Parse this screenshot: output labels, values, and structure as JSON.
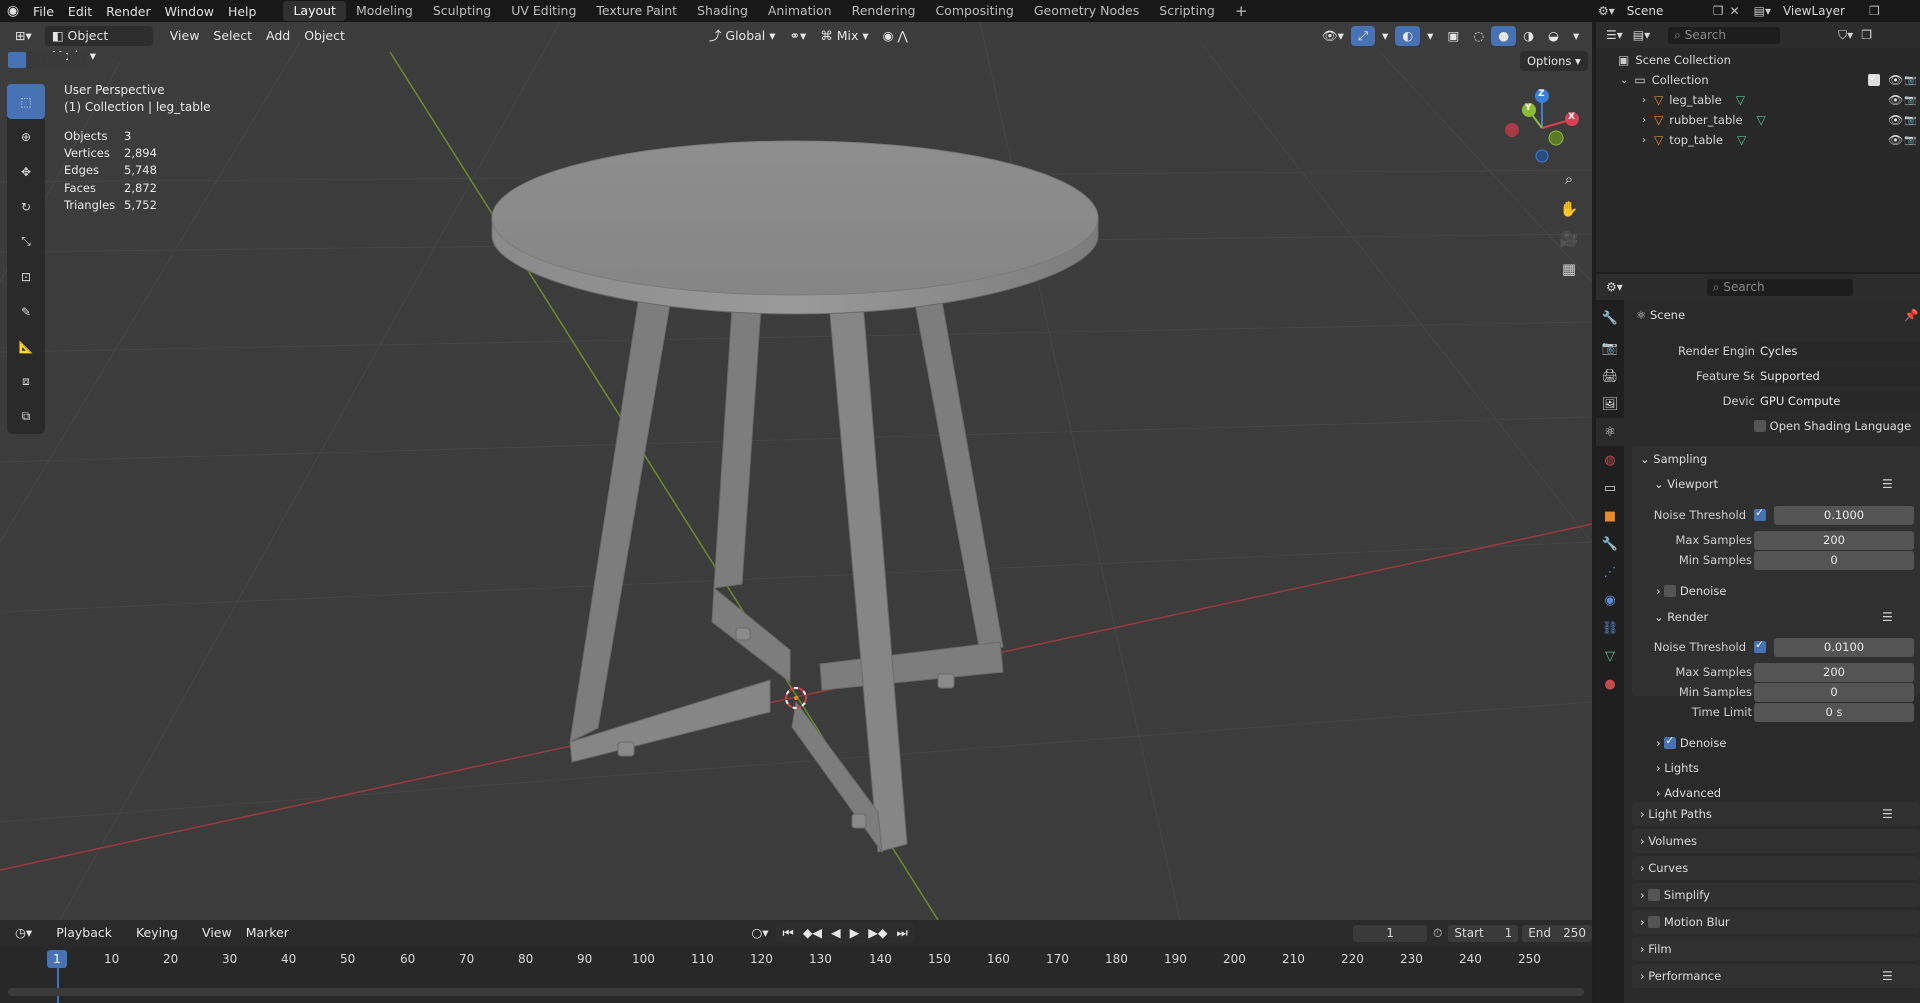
{
  "top_menu": {
    "items": [
      "File",
      "Edit",
      "Render",
      "Window",
      "Help"
    ]
  },
  "workspaces": {
    "tabs": [
      "Layout",
      "Modeling",
      "Sculpting",
      "UV Editing",
      "Texture Paint",
      "Shading",
      "Animation",
      "Rendering",
      "Compositing",
      "Geometry Nodes",
      "Scripting"
    ],
    "active": "Layout",
    "add": "+"
  },
  "scene_selector": {
    "scene": "Scene",
    "view_layer": "ViewLayer"
  },
  "viewport_header": {
    "mode": "Object Mode",
    "view": "View",
    "select": "Select",
    "add": "Add",
    "object": "Object",
    "orientation": "Global",
    "pivot": "Mix",
    "options": "Options"
  },
  "viewport_overlay": {
    "perspective": "User Perspective",
    "collection": "(1) Collection | leg_table",
    "stats": [
      {
        "label": "Objects",
        "value": "3"
      },
      {
        "label": "Vertices",
        "value": "2,894"
      },
      {
        "label": "Edges",
        "value": "5,748"
      },
      {
        "label": "Faces",
        "value": "2,872"
      },
      {
        "label": "Triangles",
        "value": "5,752"
      }
    ]
  },
  "gizmo_axes": {
    "x": "X",
    "y": "Y",
    "z": "Z"
  },
  "timeline": {
    "playback": "Playback",
    "keying": "Keying",
    "view": "View",
    "marker": "Marker",
    "current_frame": "1",
    "start_label": "Start",
    "start": "1",
    "end_label": "End",
    "end": "250",
    "ruler_current": "1",
    "ticks": [
      "10",
      "20",
      "30",
      "40",
      "50",
      "60",
      "70",
      "80",
      "90",
      "100",
      "110",
      "120",
      "130",
      "140",
      "150",
      "160",
      "170",
      "180",
      "190",
      "200",
      "210",
      "220",
      "230",
      "240",
      "250"
    ]
  },
  "outliner": {
    "search_placeholder": "Search",
    "scene_collection": "Scene Collection",
    "collection": "Collection",
    "objects": [
      "leg_table",
      "rubber_table",
      "top_table"
    ]
  },
  "properties": {
    "search_placeholder": "Search",
    "context": "Scene",
    "render_engine_label": "Render Engine",
    "render_engine": "Cycles",
    "feature_set_label": "Feature Set",
    "feature_set": "Supported",
    "device_label": "Device",
    "device": "GPU Compute",
    "osl_label": "Open Shading Language",
    "sampling": "Sampling",
    "viewport": "Viewport",
    "vp_noise_label": "Noise Threshold",
    "vp_noise": "0.1000",
    "vp_max_label": "Max Samples",
    "vp_max": "200",
    "vp_min_label": "Min Samples",
    "vp_min": "0",
    "vp_denoise": "Denoise",
    "render": "Render",
    "r_noise_label": "Noise Threshold",
    "r_noise": "0.0100",
    "r_max_label": "Max Samples",
    "r_max": "200",
    "r_min_label": "Min Samples",
    "r_min": "0",
    "r_time_label": "Time Limit",
    "r_time": "0 s",
    "r_denoise": "Denoise",
    "lights": "Lights",
    "advanced": "Advanced",
    "light_paths": "Light Paths",
    "volumes": "Volumes",
    "curves": "Curves",
    "simplify": "Simplify",
    "motion_blur": "Motion Blur",
    "film": "Film",
    "performance": "Performance"
  },
  "colors": {
    "accent": "#4772b3",
    "x_axis": "#d94152",
    "y_axis": "#8bbc34",
    "z_axis": "#3b7fd6",
    "object_orange": "#e58a2c",
    "mesh_green": "#4fc48a"
  }
}
